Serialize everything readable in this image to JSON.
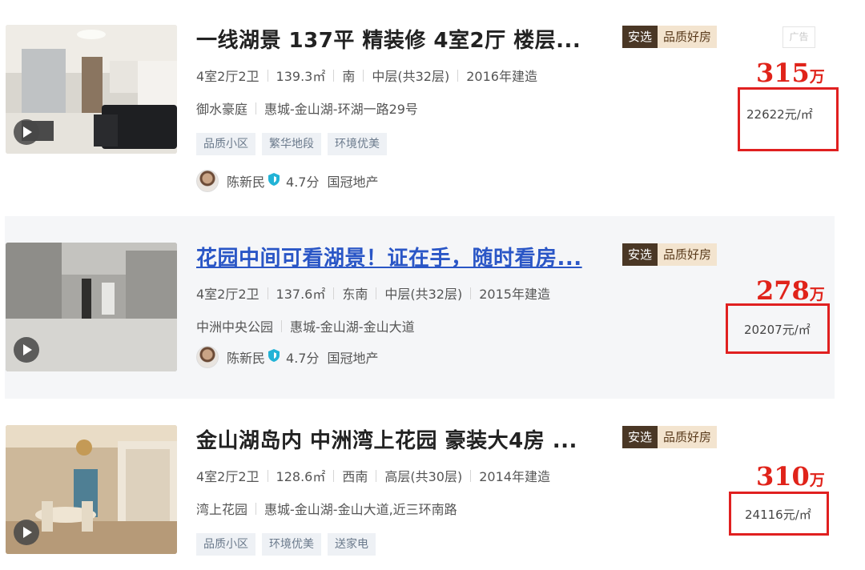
{
  "ad_label": "广告",
  "tag_primary": "安选",
  "tag_secondary": "品质好房",
  "listings": [
    {
      "title": "一线湖景 137平 精装修 4室2厅 楼层...",
      "layout": "4室2厅2卫",
      "area": "139.3㎡",
      "direction": "南",
      "floor": "中层(共32层)",
      "built": "2016年建造",
      "community": "御水豪庭",
      "location": "惠城-金山湖-环湖一路29号",
      "tags": [
        "品质小区",
        "繁华地段",
        "环境优美"
      ],
      "agent": {
        "name": "陈新民",
        "score": "4.7分",
        "company": "国冠地产"
      },
      "price": "315",
      "price_unit": "万",
      "unit_price": "22622元/㎡"
    },
    {
      "title": "花园中间可看湖景！证在手，随时看房...",
      "layout": "4室2厅2卫",
      "area": "137.6㎡",
      "direction": "东南",
      "floor": "中层(共32层)",
      "built": "2015年建造",
      "community": "中洲中央公园",
      "location": "惠城-金山湖-金山大道",
      "agent": {
        "name": "陈新民",
        "score": "4.7分",
        "company": "国冠地产"
      },
      "price": "278",
      "price_unit": "万",
      "unit_price": "20207元/㎡"
    },
    {
      "title": "金山湖岛内 中洲湾上花园 豪装大4房 ...",
      "layout": "4室2厅2卫",
      "area": "128.6㎡",
      "direction": "西南",
      "floor": "高层(共30层)",
      "built": "2014年建造",
      "community": "湾上花园",
      "location": "惠城-金山湖-金山大道,近三环南路",
      "tags": [
        "品质小区",
        "环境优美",
        "送家电"
      ],
      "price": "310",
      "price_unit": "万",
      "unit_price": "24116元/㎡"
    }
  ]
}
